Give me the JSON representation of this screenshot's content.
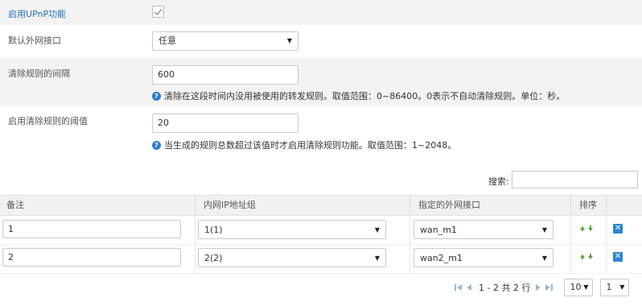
{
  "form": {
    "enable_upnp": {
      "label": "启用UPnP功能",
      "checked": true
    },
    "default_wan": {
      "label": "默认外网接口",
      "value": "任意"
    },
    "clear_interval": {
      "label": "清除规则的间隔",
      "value": "600",
      "hint": "清除在这段时间内没用被使用的转发规则。取值范围：0~86400。0表示不自动清除规则。单位：秒。"
    },
    "clear_threshold": {
      "label": "启用清除规则的阈值",
      "value": "20",
      "hint": "当生成的规则总数超过该值时才启用清除规则功能。取值范围：1~2048。"
    }
  },
  "search": {
    "label": "搜索:",
    "value": ""
  },
  "table": {
    "headers": [
      "备注",
      "内网IP地址组",
      "指定的外网接口",
      "排序"
    ],
    "rows": [
      {
        "remark": "1",
        "ip_group": "1(1)",
        "wan": "wan_m1"
      },
      {
        "remark": "2",
        "ip_group": "2(2)",
        "wan": "wan2_m1"
      }
    ]
  },
  "pager": {
    "info": "1 - 2 共 2 行",
    "page_size": "10",
    "page": "1"
  },
  "colors": {
    "accent_blue": "#1f6fb9",
    "icon_blue": "#2c85d4",
    "sort_green": "#5aa53a",
    "row_gray": "#f3f3f3"
  },
  "icons": {
    "hint": "question-circle-icon",
    "delete": "close-icon",
    "sort_up": "arrow-up-icon",
    "sort_down": "arrow-down-icon"
  }
}
